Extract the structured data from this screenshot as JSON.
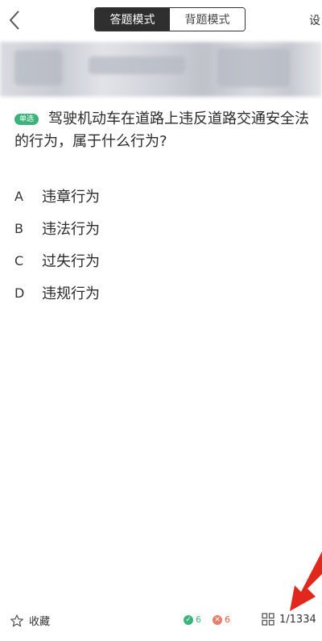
{
  "header": {
    "tabs": [
      {
        "label": "答题模式",
        "active": true
      },
      {
        "label": "背题模式",
        "active": false
      }
    ],
    "settings_label": "设"
  },
  "question": {
    "type_badge": "单选",
    "text": "驾驶机动车在道路上违反道路交通安全法的行为，属于什么行为?"
  },
  "options": [
    {
      "letter": "A",
      "text": "违章行为"
    },
    {
      "letter": "B",
      "text": "违法行为"
    },
    {
      "letter": "C",
      "text": "过失行为"
    },
    {
      "letter": "D",
      "text": "违规行为"
    }
  ],
  "footer": {
    "favorite_label": "收藏",
    "correct_count": "6",
    "wrong_count": "6",
    "progress": "1/1334"
  },
  "colors": {
    "accent_green": "#3bb37a",
    "wrong_red": "#e25b45",
    "segment_active_bg": "#2f2f2f",
    "arrow_red": "#e0291c"
  }
}
